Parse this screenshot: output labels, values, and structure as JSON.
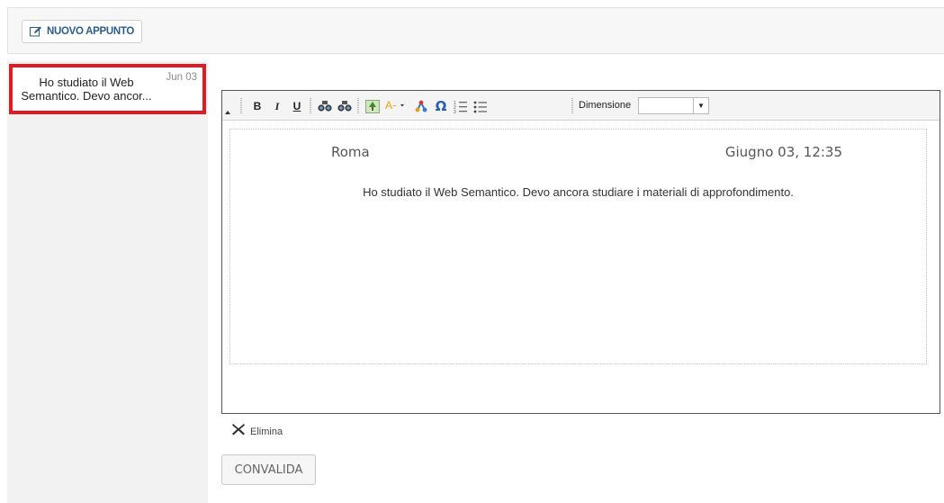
{
  "toolbar": {
    "new_note_label": "NUOVO APPUNTO",
    "new_note_icon": "edit-icon"
  },
  "notes": [
    {
      "title": "Ho studiato il Web Semantico. Devo ancor...",
      "date": "Jun 03",
      "selected": true,
      "highlight_color": "#e01b24"
    }
  ],
  "editor": {
    "toolbar": {
      "buttons": [
        {
          "name": "bold",
          "label": "B"
        },
        {
          "name": "italic",
          "label": "I"
        },
        {
          "name": "underline",
          "label": "U"
        },
        {
          "name": "find",
          "icon": "binoculars-icon"
        },
        {
          "name": "replace",
          "icon": "binoculars-icon"
        },
        {
          "name": "image",
          "icon": "image-icon"
        },
        {
          "name": "text-color",
          "icon": "text-color-icon"
        },
        {
          "name": "link",
          "icon": "share-link-icon"
        },
        {
          "name": "special-char",
          "label": "Ω"
        },
        {
          "name": "numbered-list",
          "icon": "numbered-list-icon"
        },
        {
          "name": "bullet-list",
          "icon": "bullet-list-icon"
        }
      ],
      "size_label": "Dimensione",
      "size_value": ""
    },
    "city": "Roma",
    "datetime": "Giugno 03, 12:35",
    "content": "Ho studiato il Web Semantico. Devo ancora studiare i materiali di approfondimento."
  },
  "actions": {
    "delete_label": "Elimina",
    "validate_label": "CONVALIDA"
  }
}
